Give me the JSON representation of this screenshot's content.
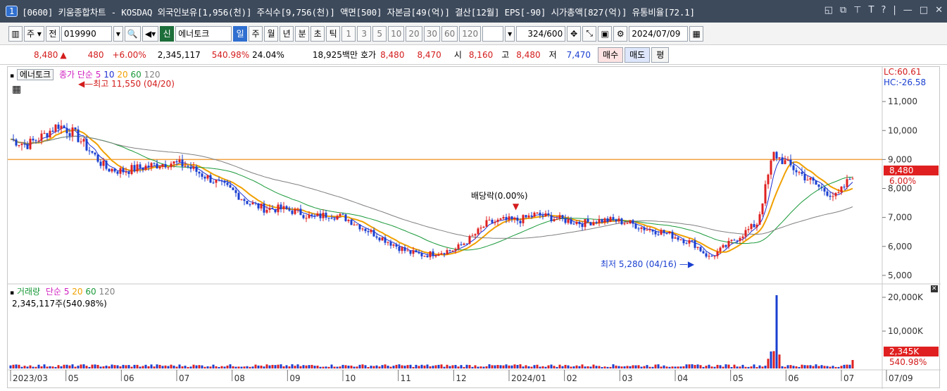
{
  "titlebar": {
    "window_number": "1",
    "title": "[0600] 키움종합차트 - KOSDAQ 외국인보유[1,956(천)] 주식수[9,756(천)] 액면[500] 자본금[49(억)] 결산[12월] EPS[-90] 시가총액[827(억)] 유통비율[72.1]",
    "buttons": [
      "◱",
      "⧉",
      "⊤",
      "T",
      "?",
      "|",
      "—",
      "□",
      "✕"
    ]
  },
  "toolbar": {
    "mode": "주",
    "prev": "전",
    "code": "019990",
    "name_badge": "신",
    "name": "에너토크",
    "periods": [
      "일",
      "주",
      "월",
      "년",
      "분",
      "초",
      "틱"
    ],
    "selected_period": "일",
    "intervals": [
      "1",
      "3",
      "5",
      "10",
      "20",
      "30",
      "60",
      "120"
    ],
    "count": "324",
    "count_total": "/600",
    "date": "2024/07/09"
  },
  "quote": {
    "price": "8,480",
    "arrow": "▲",
    "change": "480",
    "change_pct": "+6.00%",
    "volume": "2,345,117",
    "volume_ratio": "540.98%",
    "turnover": "24.04%",
    "amount": "18,925백만",
    "ask_label": "호가",
    "ask1": "8,480",
    "ask2": "8,470",
    "open_label": "시",
    "open": "8,160",
    "high_label": "고",
    "high": "8,480",
    "low_label": "저",
    "low": "7,470",
    "buy": "매수",
    "sell": "매도",
    "eval": "평"
  },
  "price_panel": {
    "legend_name": "에너토크",
    "legend_close": "종가",
    "legend_type": "단순",
    "ma_periods": [
      "5",
      "10",
      "20",
      "60",
      "120"
    ],
    "ma_colors": [
      "#d020c0",
      "#2030d0",
      "#f0a000",
      "#1a9a3a",
      "#808080"
    ],
    "high_label": "최고 11,550 (04/20)",
    "low_label": "최저 5,280 (04/16)",
    "dividend_label": "배당락(0.00%)",
    "lc": "LC:60.61",
    "hc": "HC:-26.58",
    "current_price_tag": "8,480",
    "current_pct_tag": "6.00%",
    "hline_color": "#f0a040"
  },
  "volume_panel": {
    "legend_name": "거래량",
    "legend_type": "단순",
    "ma_periods": [
      "5",
      "20",
      "60",
      "120"
    ],
    "value_label": "2,345,117주(540.98%)",
    "current_tag": "2,345K",
    "pct_tag": "540.98%"
  },
  "chart_data": {
    "type": "line",
    "price_axis": {
      "ticks": [
        "11,000",
        "10,000",
        "9,000",
        "8,000",
        "7,000",
        "6,000",
        "5,000"
      ],
      "ylim": [
        4900,
        12000
      ]
    },
    "volume_axis": {
      "ticks": [
        "20,000K",
        "10,000K"
      ]
    },
    "x_labels": [
      "2023/03",
      "05",
      "06",
      "07",
      "08",
      "09",
      "10",
      "11",
      "12",
      "2024/01",
      "02",
      "03",
      "04",
      "05",
      "06",
      "07",
      "07/09"
    ],
    "close": [
      9700,
      9500,
      9800,
      10200,
      9900,
      9300,
      8700,
      8600,
      8700,
      8800,
      8900,
      8800,
      8500,
      8200,
      7900,
      7500,
      7300,
      7300,
      7200,
      7000,
      7100,
      7000,
      6700,
      6400,
      6100,
      5800,
      5700,
      5800,
      5900,
      6300,
      6800,
      6900,
      6900,
      7100,
      7000,
      6900,
      6800,
      6900,
      6900,
      6800,
      6600,
      6500,
      6300,
      6100,
      5600,
      6000,
      6400,
      6800,
      9200,
      8800,
      8400,
      8000,
      7700,
      8480
    ],
    "ma_reference_hline": 9000
  }
}
